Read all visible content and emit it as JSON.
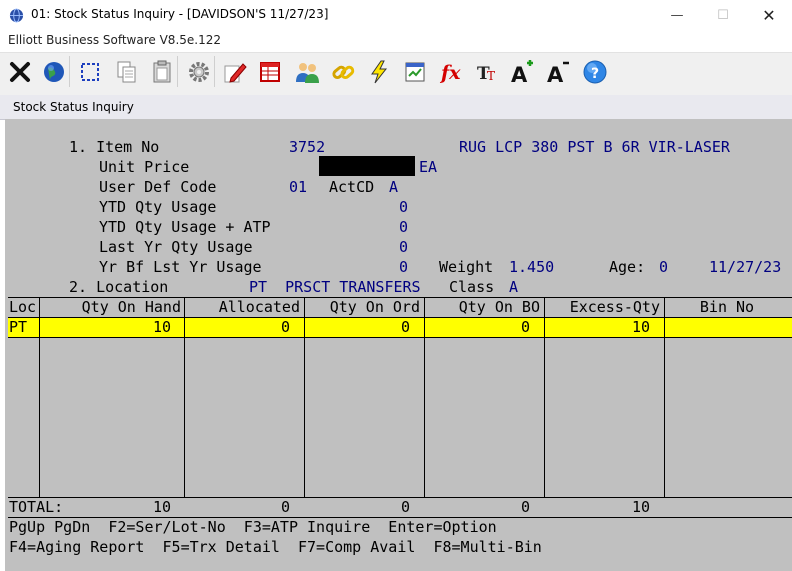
{
  "window": {
    "title": "01: Stock Status Inquiry - [DAVIDSON'S 11/27/23]",
    "app_name": "Elliott Business Software V8.5e.122",
    "minimize_glyph": "—",
    "maximize_glyph": "☐",
    "close_glyph": "✕"
  },
  "toolbar": {
    "buttons": [
      "exit-icon",
      "globe-icon",
      "select-icon",
      "copy-icon",
      "paste-icon",
      "settings-icon",
      "edit-icon",
      "spreadsheet-icon",
      "users-icon",
      "link-icon",
      "lightning-icon",
      "report-icon",
      "function-icon",
      "font-size-icon",
      "font-increase-icon",
      "font-decrease-icon",
      "help-icon"
    ]
  },
  "form": {
    "header": "Stock Status Inquiry",
    "item_label": "1. Item No",
    "item_no": "3752",
    "item_desc": "RUG LCP 380 PST B 6R VIR-LASER",
    "unit_price_label": "Unit Price",
    "uom": "EA",
    "user_def_label": "User Def Code",
    "user_def_value": "01",
    "actcd_label": "ActCD",
    "actcd_value": "A",
    "ytd_usage_label": "YTD Qty Usage",
    "ytd_usage_value": "0",
    "ytd_atp_label": "YTD Qty Usage + ATP",
    "ytd_atp_value": "0",
    "last_yr_label": "Last Yr Qty Usage",
    "last_yr_value": "0",
    "yr_bf_label": "Yr Bf Lst Yr Usage",
    "yr_bf_value": "0",
    "weight_label": "Weight",
    "weight_value": "1.450",
    "age_label": "Age:",
    "age_value": "0",
    "date_value": "11/27/23",
    "location_label": "2. Location",
    "location_value": "PT  PRSCT TRANSFERS",
    "class_label": "Class",
    "class_value": "A"
  },
  "grid": {
    "headers": [
      "Loc",
      "Qty On Hand",
      "Allocated",
      "Qty On Ord",
      "Qty On BO",
      "Excess-Qty",
      "Bin No"
    ],
    "row": [
      "PT",
      "10",
      "0",
      "0",
      "0",
      "10",
      ""
    ],
    "total_label": "TOTAL:",
    "totals": [
      "10",
      "0",
      "0",
      "0",
      "10"
    ]
  },
  "footer": {
    "line1": "PgUp PgDn  F2=Ser/Lot-No  F3=ATP Inquire  Enter=Option",
    "line2": "F4=Aging Report  F5=Trx Detail  F7=Comp Avail  F8=Multi-Bin"
  }
}
